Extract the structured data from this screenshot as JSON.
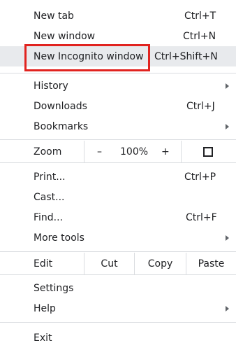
{
  "menu": {
    "new_tab": {
      "label": "New tab",
      "shortcut": "Ctrl+T"
    },
    "new_window": {
      "label": "New window",
      "shortcut": "Ctrl+N"
    },
    "new_incognito": {
      "label": "New Incognito window",
      "shortcut": "Ctrl+Shift+N"
    },
    "history": {
      "label": "History"
    },
    "downloads": {
      "label": "Downloads",
      "shortcut": "Ctrl+J"
    },
    "bookmarks": {
      "label": "Bookmarks"
    },
    "zoom": {
      "label": "Zoom",
      "minus": "–",
      "value": "100%",
      "plus": "+",
      "fullscreen_icon": "fullscreen-icon"
    },
    "print": {
      "label": "Print...",
      "shortcut": "Ctrl+P"
    },
    "cast": {
      "label": "Cast..."
    },
    "find": {
      "label": "Find...",
      "shortcut": "Ctrl+F"
    },
    "more_tools": {
      "label": "More tools"
    },
    "edit": {
      "label": "Edit",
      "cut": "Cut",
      "copy": "Copy",
      "paste": "Paste"
    },
    "settings": {
      "label": "Settings"
    },
    "help": {
      "label": "Help"
    },
    "exit": {
      "label": "Exit"
    }
  },
  "colors": {
    "highlight_box": "#e1231f",
    "hover_bg": "#e8eaed",
    "separator": "#dadce0"
  }
}
